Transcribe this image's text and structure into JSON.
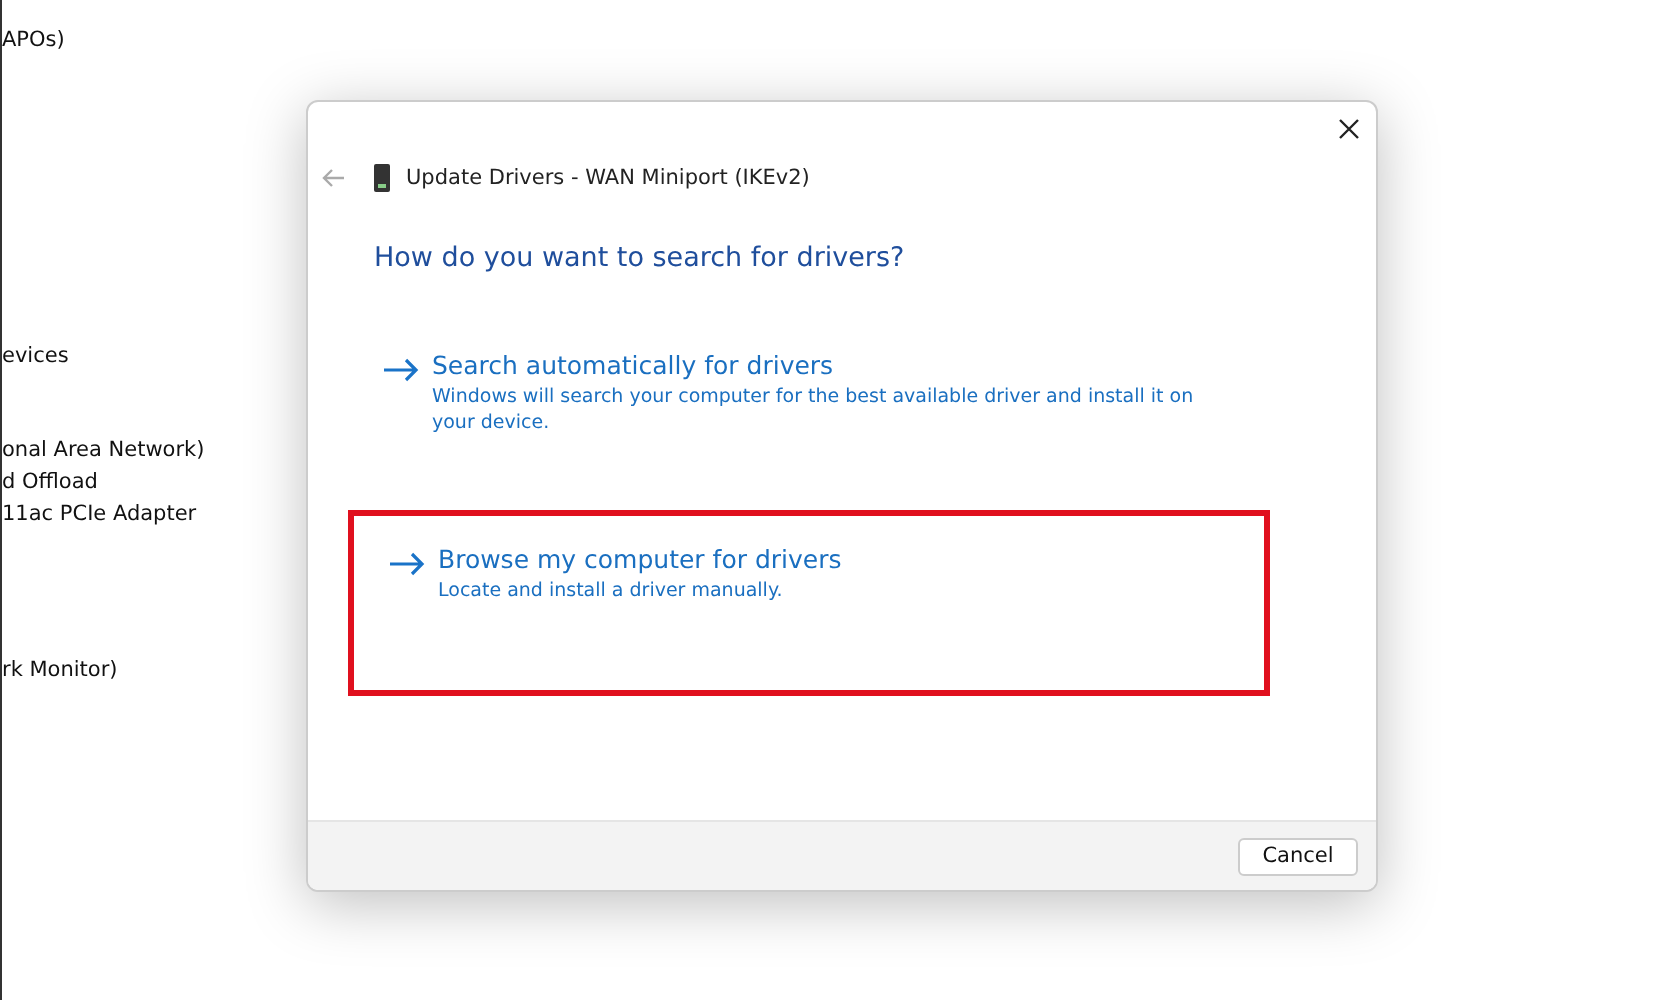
{
  "background_list": [
    "APOs)",
    "evices",
    "onal Area Network)",
    "d Offload",
    "11ac PCIe Adapter",
    "rk Monitor)"
  ],
  "dialog": {
    "title": "Update Drivers - WAN Miniport (IKEv2)",
    "heading": "How do you want to search for drivers?",
    "options": [
      {
        "title": "Search automatically for drivers",
        "description": "Windows will search your computer for the best available driver and install it on your device.",
        "highlighted": false
      },
      {
        "title": "Browse my computer for drivers",
        "description": "Locate and install a driver manually.",
        "highlighted": true
      }
    ],
    "buttons": [
      "Cancel"
    ]
  }
}
